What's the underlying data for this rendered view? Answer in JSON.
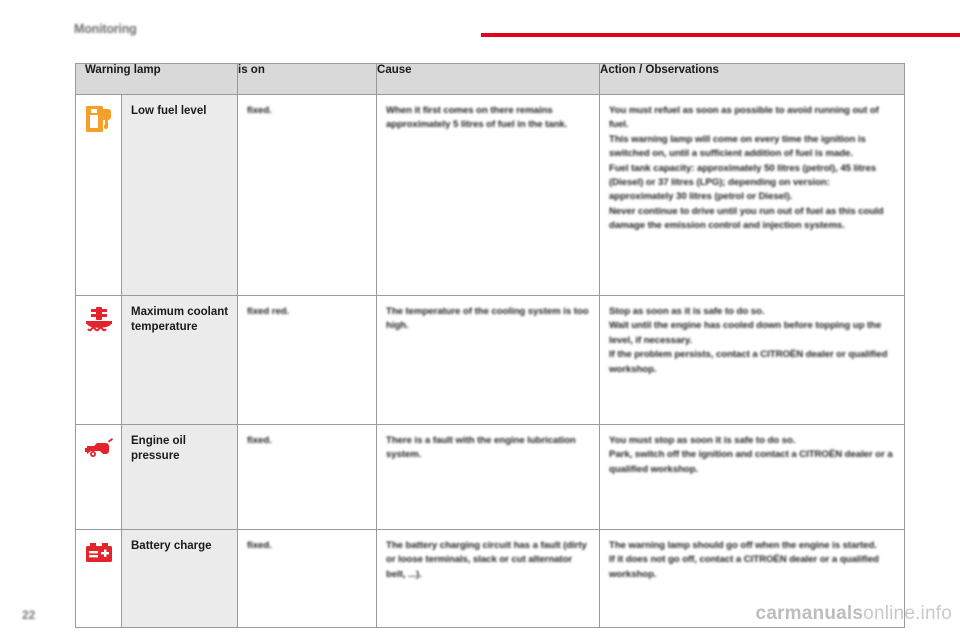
{
  "header": {
    "section_title": "Monitoring",
    "rule_color": "#e2001a"
  },
  "table": {
    "columns": [
      "Warning lamp",
      "is on",
      "Cause",
      "Action / Observations"
    ],
    "rows": [
      {
        "icon": "low-fuel-level-icon",
        "icon_color": "#f7a029",
        "name": "Low fuel level",
        "is_on": "fixed.",
        "cause": [
          "When it first comes on there remains approximately 5 litres of fuel in the tank."
        ],
        "action": [
          "You must refuel as soon as possible to avoid running out of fuel.",
          "This warning lamp will come on every time the ignition is switched on, until a sufficient addition of fuel is made.",
          "Fuel tank capacity: approximately 50 litres (petrol), 45 litres (Diesel) or 37 litres (LPG); depending on version: approximately 30 litres (petrol or Diesel).",
          "Never continue to drive until you run out of fuel as this could damage the emission control and injection systems."
        ]
      },
      {
        "icon": "coolant-temperature-icon",
        "icon_color": "#e3242b",
        "name": "Maximum coolant temperature",
        "is_on": "fixed red.",
        "cause": [
          "The temperature of the cooling system is too high."
        ],
        "action": [
          "Stop as soon as it is safe to do so.",
          "Wait until the engine has cooled down before topping up the level, if necessary.",
          "If the problem persists, contact a CITROËN dealer or qualified workshop."
        ]
      },
      {
        "icon": "engine-oil-pressure-icon",
        "icon_color": "#e3242b",
        "name": "Engine oil pressure",
        "is_on": "fixed.",
        "cause": [
          "There is a fault with the engine lubrication system."
        ],
        "action": [
          "You must stop as soon it is safe to do so.",
          "Park, switch off the ignition and contact a CITROËN dealer or a qualified workshop."
        ]
      },
      {
        "icon": "battery-charge-icon",
        "icon_color": "#e3242b",
        "name": "Battery charge",
        "is_on": "fixed.",
        "cause": [
          "The battery charging circuit has a fault (dirty or loose terminals, slack or cut alternator belt, ...)."
        ],
        "action": [
          "The warning lamp should go off when the engine is started.",
          "If it does not go off, contact a CITROËN dealer or a qualified workshop."
        ]
      }
    ]
  },
  "footer": {
    "page_number": "22",
    "watermark_prefix": "carmanuals",
    "watermark_suffix": "online.info"
  }
}
